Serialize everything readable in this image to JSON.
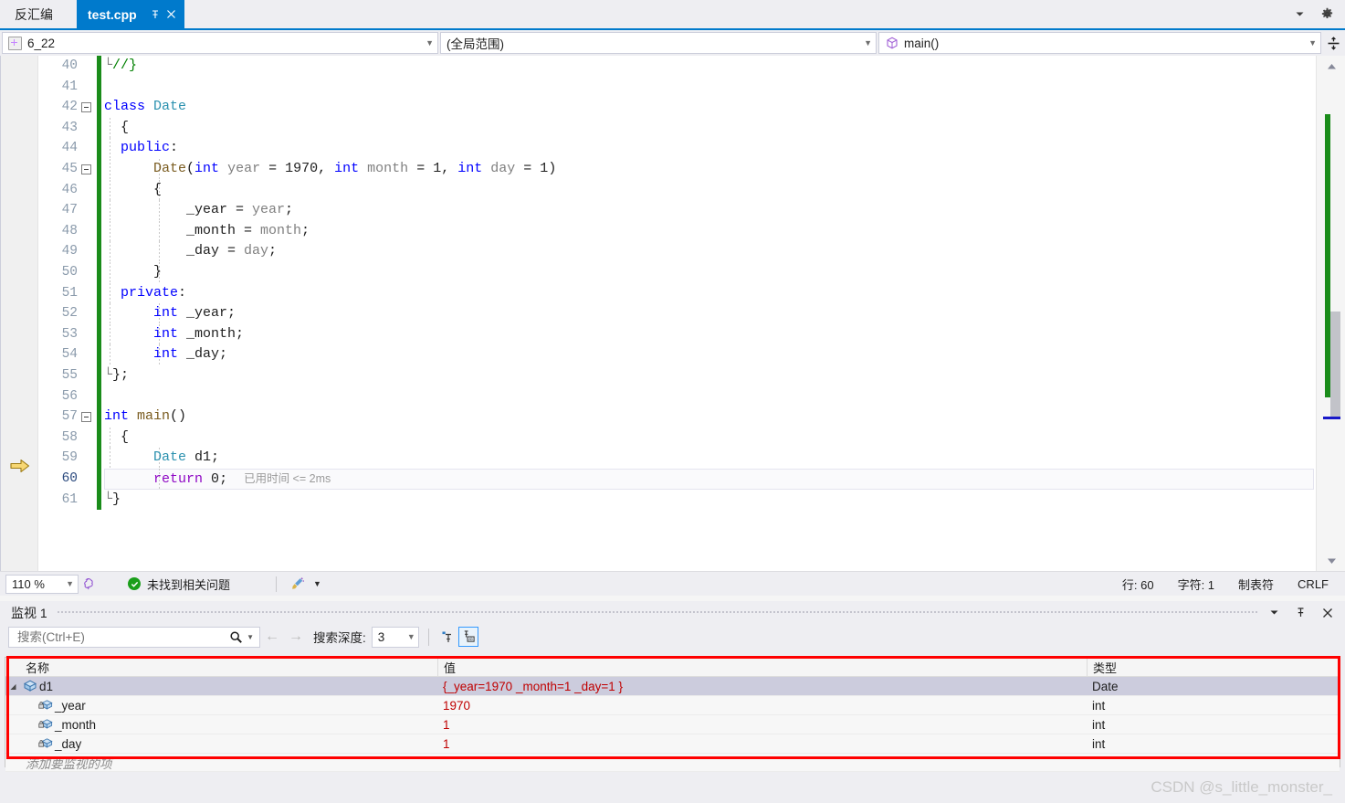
{
  "tabs": {
    "inactive_label": "反汇编",
    "active_label": "test.cpp",
    "pin_icon": "pin-icon",
    "close_icon": "close-icon",
    "chevron_icon": "chevron-down-icon",
    "gear_icon": "gear-icon"
  },
  "navbar": {
    "project": "6_22",
    "scope": "(全局范围)",
    "member": "main()",
    "split_icon": "split-view-icon"
  },
  "editor": {
    "lines": [
      {
        "num": "40",
        "text": "//}"
      },
      {
        "num": "41",
        "text": ""
      },
      {
        "num": "42",
        "text": "class Date"
      },
      {
        "num": "43",
        "text": "{"
      },
      {
        "num": "44",
        "text": "public:"
      },
      {
        "num": "45",
        "text": "Date(int year = 1970, int month = 1, int day = 1)"
      },
      {
        "num": "46",
        "text": "{"
      },
      {
        "num": "47",
        "text": "_year = year;"
      },
      {
        "num": "48",
        "text": "_month = month;"
      },
      {
        "num": "49",
        "text": "_day = day;"
      },
      {
        "num": "50",
        "text": "}"
      },
      {
        "num": "51",
        "text": "private:"
      },
      {
        "num": "52",
        "text": "int _year;"
      },
      {
        "num": "53",
        "text": "int _month;"
      },
      {
        "num": "54",
        "text": "int _day;"
      },
      {
        "num": "55",
        "text": "};"
      },
      {
        "num": "56",
        "text": ""
      },
      {
        "num": "57",
        "text": "int main()"
      },
      {
        "num": "58",
        "text": "{"
      },
      {
        "num": "59",
        "text": "Date d1;"
      },
      {
        "num": "60",
        "text": "return 0;"
      },
      {
        "num": "61",
        "text": "}"
      }
    ],
    "elapsed_annotation": "已用时间 <= 2ms",
    "current_line": "60"
  },
  "statusbar": {
    "zoom": "110 %",
    "issues": "未找到相关问题",
    "ok_icon": "check-circle-icon",
    "brain_icon": "intellicode-icon",
    "broom_icon": "code-cleanup-icon",
    "line": "行: 60",
    "column": "字符: 1",
    "tabs_mode": "制表符",
    "eol": "CRLF"
  },
  "watch": {
    "title": "监视 1",
    "search_placeholder": "搜索(Ctrl+E)",
    "search_icon": "search-icon",
    "back_icon": "arrow-left-icon",
    "forward_icon": "arrow-right-icon",
    "depth_label": "搜索深度:",
    "depth_value": "3",
    "pin_tool_icon": "pin-tool-icon",
    "pin_ab_tool_icon": "pin-ab-tool-icon",
    "chevron_icon": "chevron-down-icon",
    "pin_icon": "pin-icon",
    "close_icon": "close-icon",
    "columns": {
      "name": "名称",
      "value": "值",
      "type": "类型"
    },
    "rows": [
      {
        "name": "d1",
        "value": "{_year=1970 _month=1 _day=1 }",
        "type": "Date",
        "icon": "object-icon",
        "level": 0,
        "expanded": true,
        "selected": true
      },
      {
        "name": "_year",
        "value": "1970",
        "type": "int",
        "icon": "private-field-icon",
        "level": 1,
        "expanded": false,
        "selected": false
      },
      {
        "name": "_month",
        "value": "1",
        "type": "int",
        "icon": "private-field-icon",
        "level": 1,
        "expanded": false,
        "selected": false
      },
      {
        "name": "_day",
        "value": "1",
        "type": "int",
        "icon": "private-field-icon",
        "level": 1,
        "expanded": false,
        "selected": false
      }
    ],
    "add_item_placeholder": "添加要监视的项"
  },
  "watermark": "CSDN @s_little_monster_",
  "colors": {
    "accent": "#007acc",
    "changebar_green": "#1a8c1a",
    "value_red": "#c00000",
    "highlight_red": "#ff0000"
  }
}
